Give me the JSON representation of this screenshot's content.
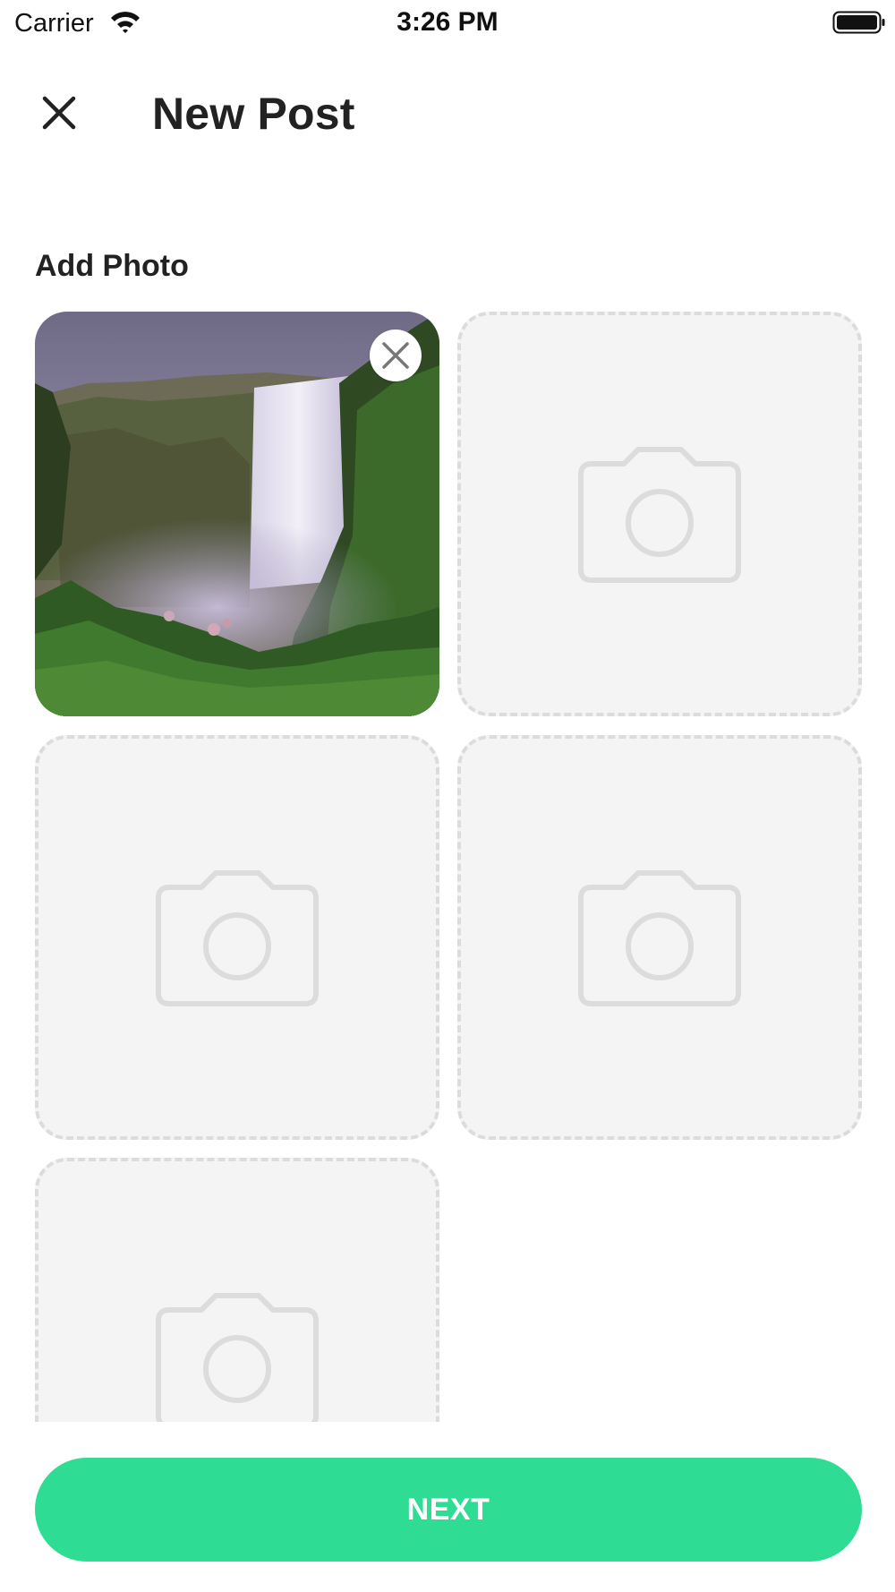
{
  "status_bar": {
    "carrier": "Carrier",
    "time": "3:26 PM",
    "icons": [
      "wifi-icon",
      "battery-icon"
    ]
  },
  "header": {
    "title": "New Post",
    "close_icon": "close-icon"
  },
  "section": {
    "label": "Add Photo"
  },
  "photos": {
    "slots": [
      {
        "state": "filled",
        "content": "waterfall photo",
        "action_icon": "remove-icon"
      },
      {
        "state": "empty",
        "icon": "camera-icon"
      },
      {
        "state": "empty",
        "icon": "camera-icon"
      },
      {
        "state": "empty",
        "icon": "camera-icon"
      },
      {
        "state": "empty",
        "icon": "camera-icon"
      }
    ]
  },
  "footer": {
    "next_label": "NEXT"
  },
  "colors": {
    "accent": "#2fdc93",
    "slot_background": "#f4f4f4",
    "slot_border": "#dcdcdc",
    "text": "#222222"
  }
}
